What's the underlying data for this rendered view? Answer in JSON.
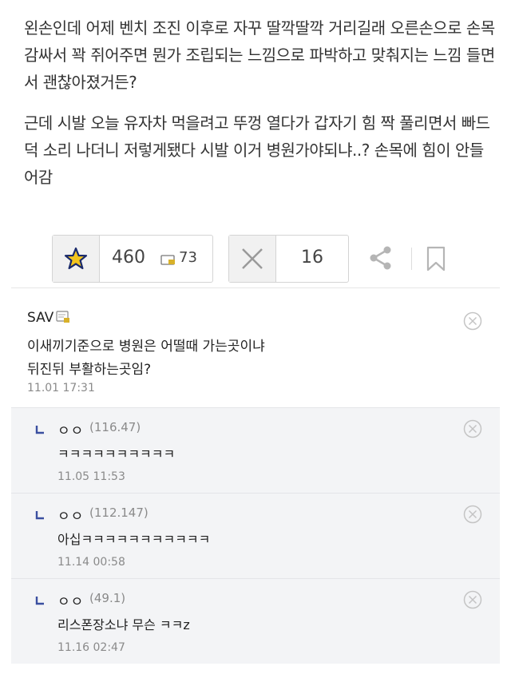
{
  "post": {
    "paragraphs": [
      "왼손인데 어제 벤치 조진 이후로 자꾸 딸깍딸깍 거리길래 오른손으로 손목 감싸서 꽉 쥐어주면 뭔가 조립되는 느낌으로 파박하고 맞춰지는 느낌 들면서 괜찮아졌거든?",
      "근데 시발 오늘 유자차 먹을려고 뚜껑 열다가 갑자기 힘 짝 풀리면서 빠드덕 소리 나더니 저렇게됐다 시발 이거 병원가야되냐..? 손목에 힘이 안들어감"
    ]
  },
  "votes": {
    "up_count": "460",
    "comment_count": "73",
    "down_count": "16",
    "up_icon": "star-icon",
    "down_icon": "x-icon",
    "colors": {
      "star_fill": "#f4c51c",
      "star_outline": "#1a2a6b",
      "box_bg": "#f1f1f1"
    }
  },
  "comments": {
    "main": {
      "author": "SAV",
      "lines": [
        "이새끼기준으로 병원은 어떨때 가는곳이냐",
        "뒤진뒤 부활하는곳임?"
      ],
      "time": "11.01 17:31"
    },
    "replies": [
      {
        "author": "ㅇㅇ",
        "ip": "(116.47)",
        "text": "ㅋㅋㅋㅋㅋㅋㅋㅋㅋㅋ",
        "time": "11.05 11:53"
      },
      {
        "author": "ㅇㅇ",
        "ip": "(112.147)",
        "text": "아십ㅋㅋㅋㅋㅋㅋㅋㅋㅋㅋㅋ",
        "time": "11.14 00:58"
      },
      {
        "author": "ㅇㅇ",
        "ip": "(49.1)",
        "text": "리스폰장소냐 무슨 ㅋㅋz",
        "time": "11.16 02:47"
      }
    ],
    "reply_bg": "#f3f4f6",
    "reply_arrow_color": "#3a4fa0"
  }
}
